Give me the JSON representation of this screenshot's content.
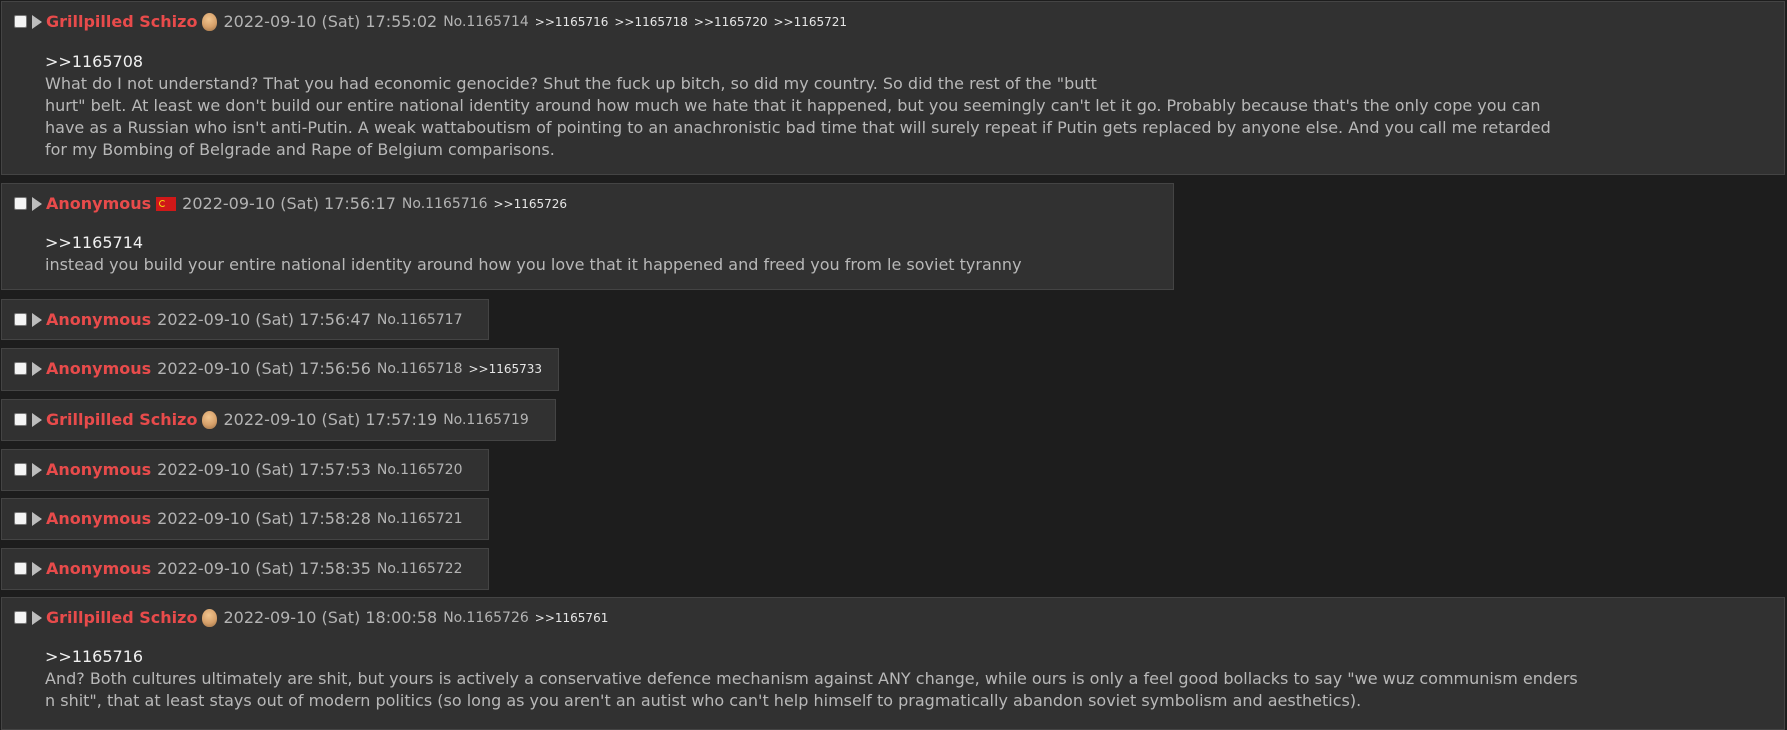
{
  "posts": [
    {
      "name": "Grillpilled Schizo",
      "has_avatar": true,
      "datetime": "2022-09-10 (Sat) 17:55:02",
      "no": "No.1165714",
      "replies": [
        ">>1165716",
        ">>1165718",
        ">>1165720",
        ">>1165721"
      ],
      "quote": ">>1165708",
      "lines": [
        "What do I not understand? That you had economic genocide? Shut the fuck up bitch, so did my country. So did the rest of the \"butt",
        "hurt\" belt. At least we don't build our entire national identity around how much we hate that it happened, but you seemingly can't let it go. Probably because that's the only cope you can",
        "have as a Russian who isn't anti-Putin. A weak wattaboutism of pointing to an anachronistic bad time that will surely repeat if Putin gets replaced by anyone else. And you call me retarded",
        "for my Bombing of Belgrade and Rape of Belgium comparisons."
      ]
    },
    {
      "name": "Anonymous",
      "has_flag": true,
      "datetime": "2022-09-10 (Sat) 17:56:17",
      "no": "No.1165716",
      "replies": [
        ">>1165726"
      ],
      "quote": ">>1165714",
      "lines": [
        "instead you build your entire national identity around how you love that it happened and freed you from le soviet tyranny"
      ]
    },
    {
      "name": "Anonymous",
      "datetime": "2022-09-10 (Sat) 17:56:47",
      "no": "No.1165717",
      "replies": []
    },
    {
      "name": "Anonymous",
      "datetime": "2022-09-10 (Sat) 17:56:56",
      "no": "No.1165718",
      "replies": [
        ">>1165733"
      ]
    },
    {
      "name": "Grillpilled Schizo",
      "has_avatar": true,
      "datetime": "2022-09-10 (Sat) 17:57:19",
      "no": "No.1165719",
      "replies": []
    },
    {
      "name": "Anonymous",
      "datetime": "2022-09-10 (Sat) 17:57:53",
      "no": "No.1165720",
      "replies": []
    },
    {
      "name": "Anonymous",
      "datetime": "2022-09-10 (Sat) 17:58:28",
      "no": "No.1165721",
      "replies": []
    },
    {
      "name": "Anonymous",
      "datetime": "2022-09-10 (Sat) 17:58:35",
      "no": "No.1165722",
      "replies": []
    },
    {
      "name": "Grillpilled Schizo",
      "has_avatar": true,
      "datetime": "2022-09-10 (Sat) 18:00:58",
      "no": "No.1165726",
      "replies": [
        ">>1165761"
      ],
      "quote": ">>1165716",
      "lines": [
        "And? Both cultures ultimately are shit, but yours is actively a conservative defence mechanism against ANY change, while ours is only a feel good bollacks to say \"we wuz communism enders",
        "n shit\", that at least stays out of modern politics (so long as you aren't an autist who can't help himself to pragmatically abandon soviet symbolism and aesthetics)."
      ]
    }
  ]
}
